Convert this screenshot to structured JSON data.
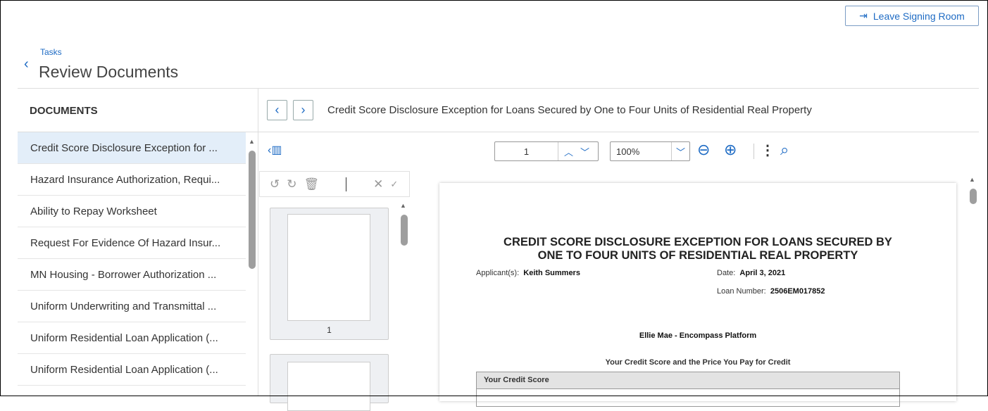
{
  "header": {
    "leave_label": "Leave Signing Room",
    "breadcrumb": "Tasks",
    "title": "Review Documents"
  },
  "sidebar": {
    "heading": "DOCUMENTS",
    "items": [
      {
        "label": "Credit Score Disclosure Exception for ..."
      },
      {
        "label": "Hazard Insurance Authorization, Requi..."
      },
      {
        "label": "Ability to Repay Worksheet"
      },
      {
        "label": "Request For Evidence Of Hazard Insur..."
      },
      {
        "label": "MN Housing - Borrower Authorization ..."
      },
      {
        "label": "Uniform Underwriting and Transmittal ..."
      },
      {
        "label": "Uniform Residential Loan Application (..."
      },
      {
        "label": "Uniform Residential Loan Application (..."
      }
    ]
  },
  "viewer": {
    "doc_title": "Credit Score Disclosure Exception for Loans Secured by One to Four Units of Residential Real Property",
    "page": "1",
    "zoom": "100%",
    "thumb_page": "1"
  },
  "document": {
    "title": "CREDIT SCORE DISCLOSURE EXCEPTION FOR LOANS SECURED BY ONE TO FOUR UNITS OF RESIDENTIAL REAL PROPERTY",
    "applicant_label": "Applicant(s):",
    "applicant": "Keith Summers",
    "date_label": "Date:",
    "date": "April 3, 2021",
    "loan_label": "Loan Number:",
    "loan": "2506EM017852",
    "company": "Ellie Mae - Encompass Platform",
    "subtitle": "Your Credit Score and the Price You Pay for Credit",
    "table_header": "Your Credit Score"
  }
}
